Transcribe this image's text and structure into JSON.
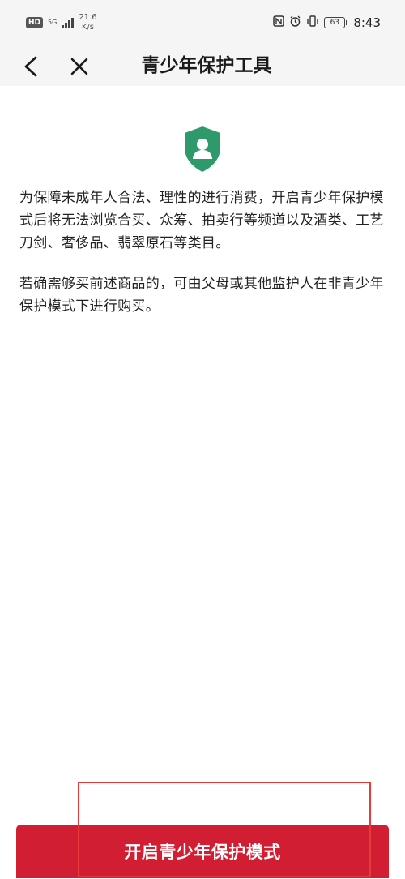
{
  "status_bar": {
    "hd_badge": "HD",
    "network_type": "5G",
    "speed_value": "21.6",
    "speed_unit": "K/s",
    "time": "8:43",
    "battery_level": "63"
  },
  "nav": {
    "title": "青少年保护工具"
  },
  "main": {
    "paragraph1": "为保障未成年人合法、理性的进行消费，开启青少年保护模式后将无法浏览合买、众筹、拍卖行等频道以及酒类、工艺刀剑、奢侈品、翡翠原石等类目。",
    "paragraph2": "若确需够买前述商品的，可由父母或其他监护人在非青少年保护模式下进行购买。"
  },
  "footer": {
    "enable_button_label": "开启青少年保护模式"
  },
  "colors": {
    "shield_green": "#2e9a6b",
    "button_red": "#d21e32",
    "highlight_red": "#e53b3b"
  }
}
